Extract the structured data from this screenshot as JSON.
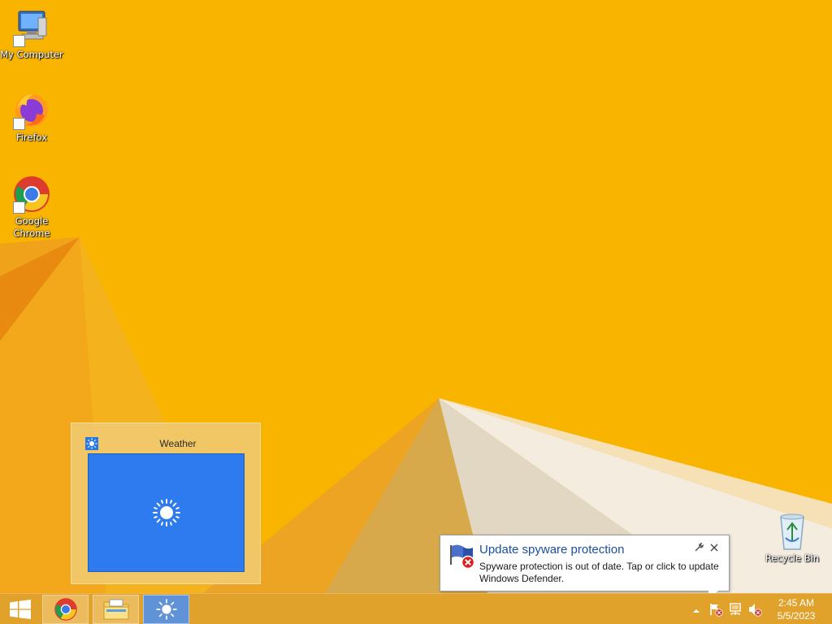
{
  "desktop": {
    "background_color": "#f9b400",
    "icons": [
      {
        "label": "My Computer",
        "icon": "computer-icon"
      },
      {
        "label": "Firefox",
        "icon": "firefox-icon"
      },
      {
        "label": "Google Chrome",
        "icon": "chrome-icon"
      },
      {
        "label": "Recycle Bin",
        "icon": "recycle-bin-icon"
      }
    ]
  },
  "thumbnail": {
    "title": "Weather",
    "icon": "sun-icon",
    "preview_color": "#2d7bee"
  },
  "notification": {
    "title": "Update spyware protection",
    "body": "Spyware protection is out of date. Tap or click to update Windows Defender.",
    "icon": "windows-defender-error-icon",
    "title_color": "#1c4fa0"
  },
  "taskbar": {
    "start_icon": "windows-logo-icon",
    "apps": [
      {
        "name": "Google Chrome",
        "icon": "chrome-icon",
        "active": false
      },
      {
        "name": "File Explorer",
        "icon": "folder-icon",
        "active": false
      },
      {
        "name": "Weather",
        "icon": "sun-icon",
        "active": true
      }
    ],
    "active_color": "#5f92d6"
  },
  "tray": {
    "icons": [
      "show-hidden-icons-chevron",
      "action-center-flag-icon",
      "network-icon",
      "volume-muted-icon"
    ],
    "time": "2:45 AM",
    "date": "5/5/2023"
  }
}
